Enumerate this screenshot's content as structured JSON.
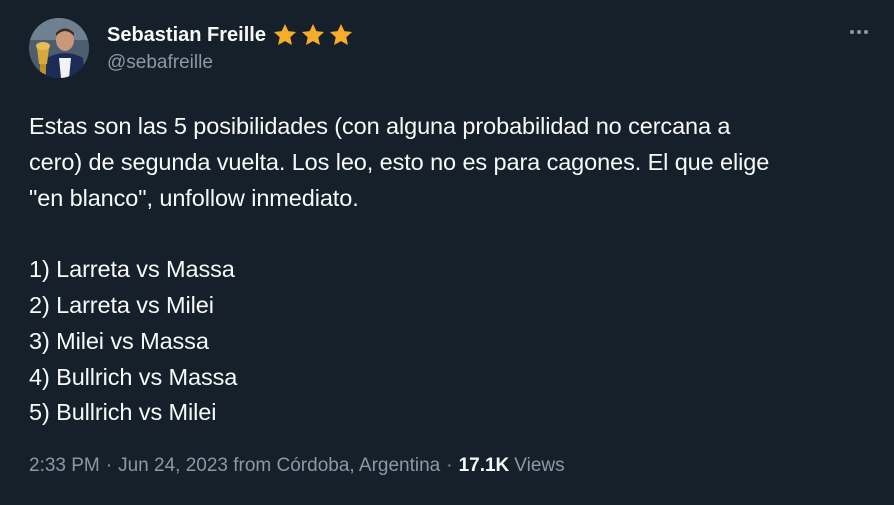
{
  "author": {
    "display_name": "Sebastian Freille",
    "handle": "@sebafreille",
    "badges": [
      "star-icon",
      "star-icon",
      "star-icon"
    ]
  },
  "more_icon": "more-horizontal-icon",
  "tweet": {
    "lines": [
      "Estas son las 5 posibilidades (con alguna probabilidad no cercana a",
      "cero) de segunda vuelta. Los leo, esto no es para cagones. El que elige",
      "\"en blanco\", unfollow inmediato.",
      "",
      "1) Larreta vs Massa",
      "2) Larreta vs Milei",
      "3) Milei vs Massa",
      "4) Bullrich vs Massa",
      "5) Bullrich vs Milei"
    ]
  },
  "meta": {
    "time": "2:33 PM",
    "separator": "·",
    "date": "Jun 24, 2023 from Córdoba, Argentina",
    "views_count": "17.1K",
    "views_label": "Views"
  },
  "colors": {
    "background": "#15202b",
    "text": "#f7f9f9",
    "secondary": "#8b98a5",
    "star": "#f6ad2a"
  }
}
